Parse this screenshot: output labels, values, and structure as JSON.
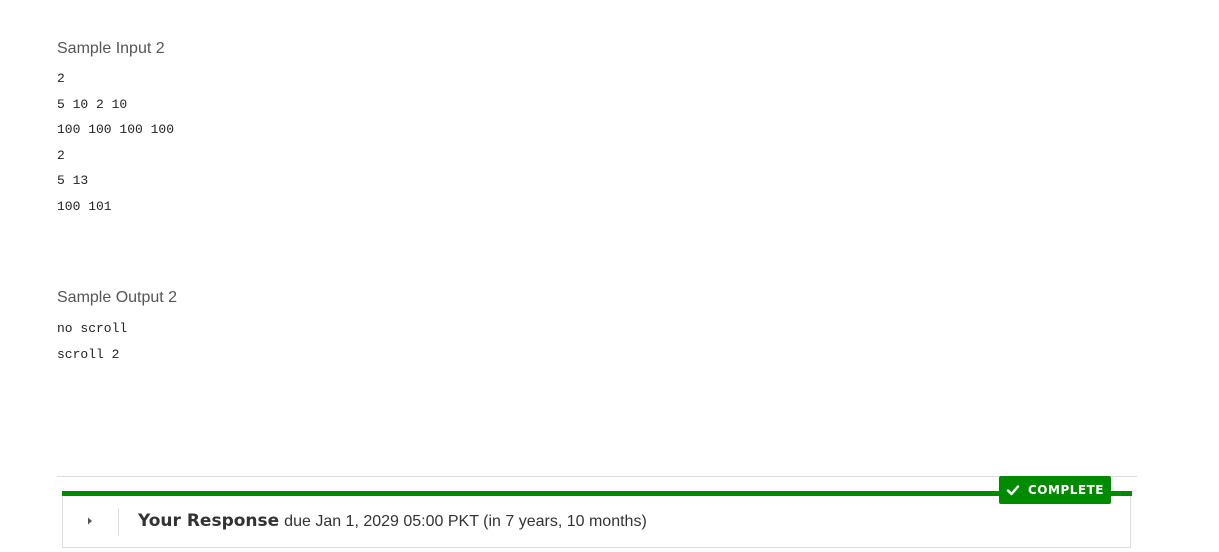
{
  "sample_input": {
    "heading": "Sample Input 2",
    "lines": [
      "2",
      "5 10 2 10",
      "100 100 100 100",
      "2",
      "5 13",
      "100 101"
    ]
  },
  "sample_output": {
    "heading": "Sample Output 2",
    "lines": [
      "no scroll",
      "scroll 2"
    ]
  },
  "response": {
    "status_label": "COMPLETE",
    "status_icon": "checkmark-icon",
    "toggle_icon": "caret-right-icon",
    "title": "Your Response",
    "due_text": "due Jan 1, 2029 05:00 PKT (in 7 years, 10 months)"
  },
  "colors": {
    "accent_green": "#008a00",
    "border": "#dddddd"
  }
}
